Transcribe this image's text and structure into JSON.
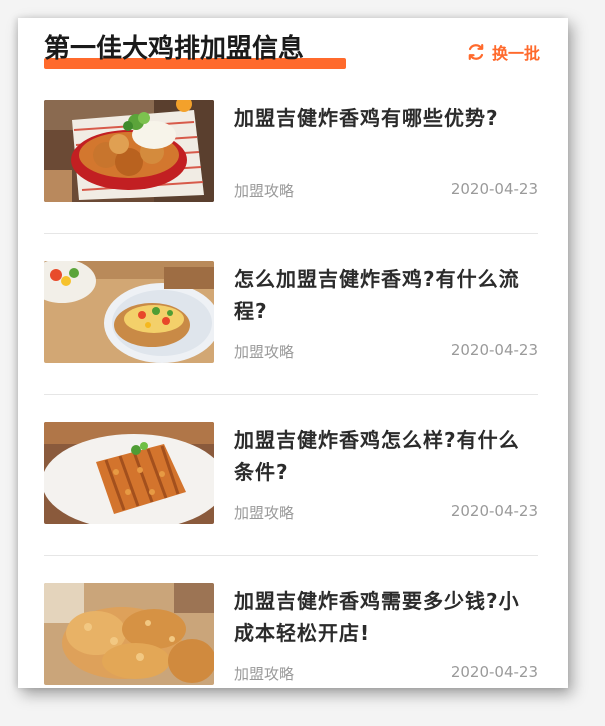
{
  "header": {
    "title": "第一佳大鸡排加盟信息",
    "refresh_label": "换一批",
    "accent_color": "#ff6a2c"
  },
  "articles": [
    {
      "title": "加盟吉健炸香鸡有哪些优势?",
      "tag": "加盟攻略",
      "date": "2020-04-23",
      "thumbnail": "fried-chicken-basket-image"
    },
    {
      "title": "怎么加盟吉健炸香鸡?有什么流程?",
      "tag": "加盟攻略",
      "date": "2020-04-23",
      "thumbnail": "chicken-with-vegetables-plate-image"
    },
    {
      "title": "加盟吉健炸香鸡怎么样?有什么条件?",
      "tag": "加盟攻略",
      "date": "2020-04-23",
      "thumbnail": "sliced-chicken-cutlet-image"
    },
    {
      "title": "加盟吉健炸香鸡需要多少钱?小成本轻松开店!",
      "tag": "加盟攻略",
      "date": "2020-04-23",
      "thumbnail": "fried-chicken-wings-image"
    }
  ]
}
